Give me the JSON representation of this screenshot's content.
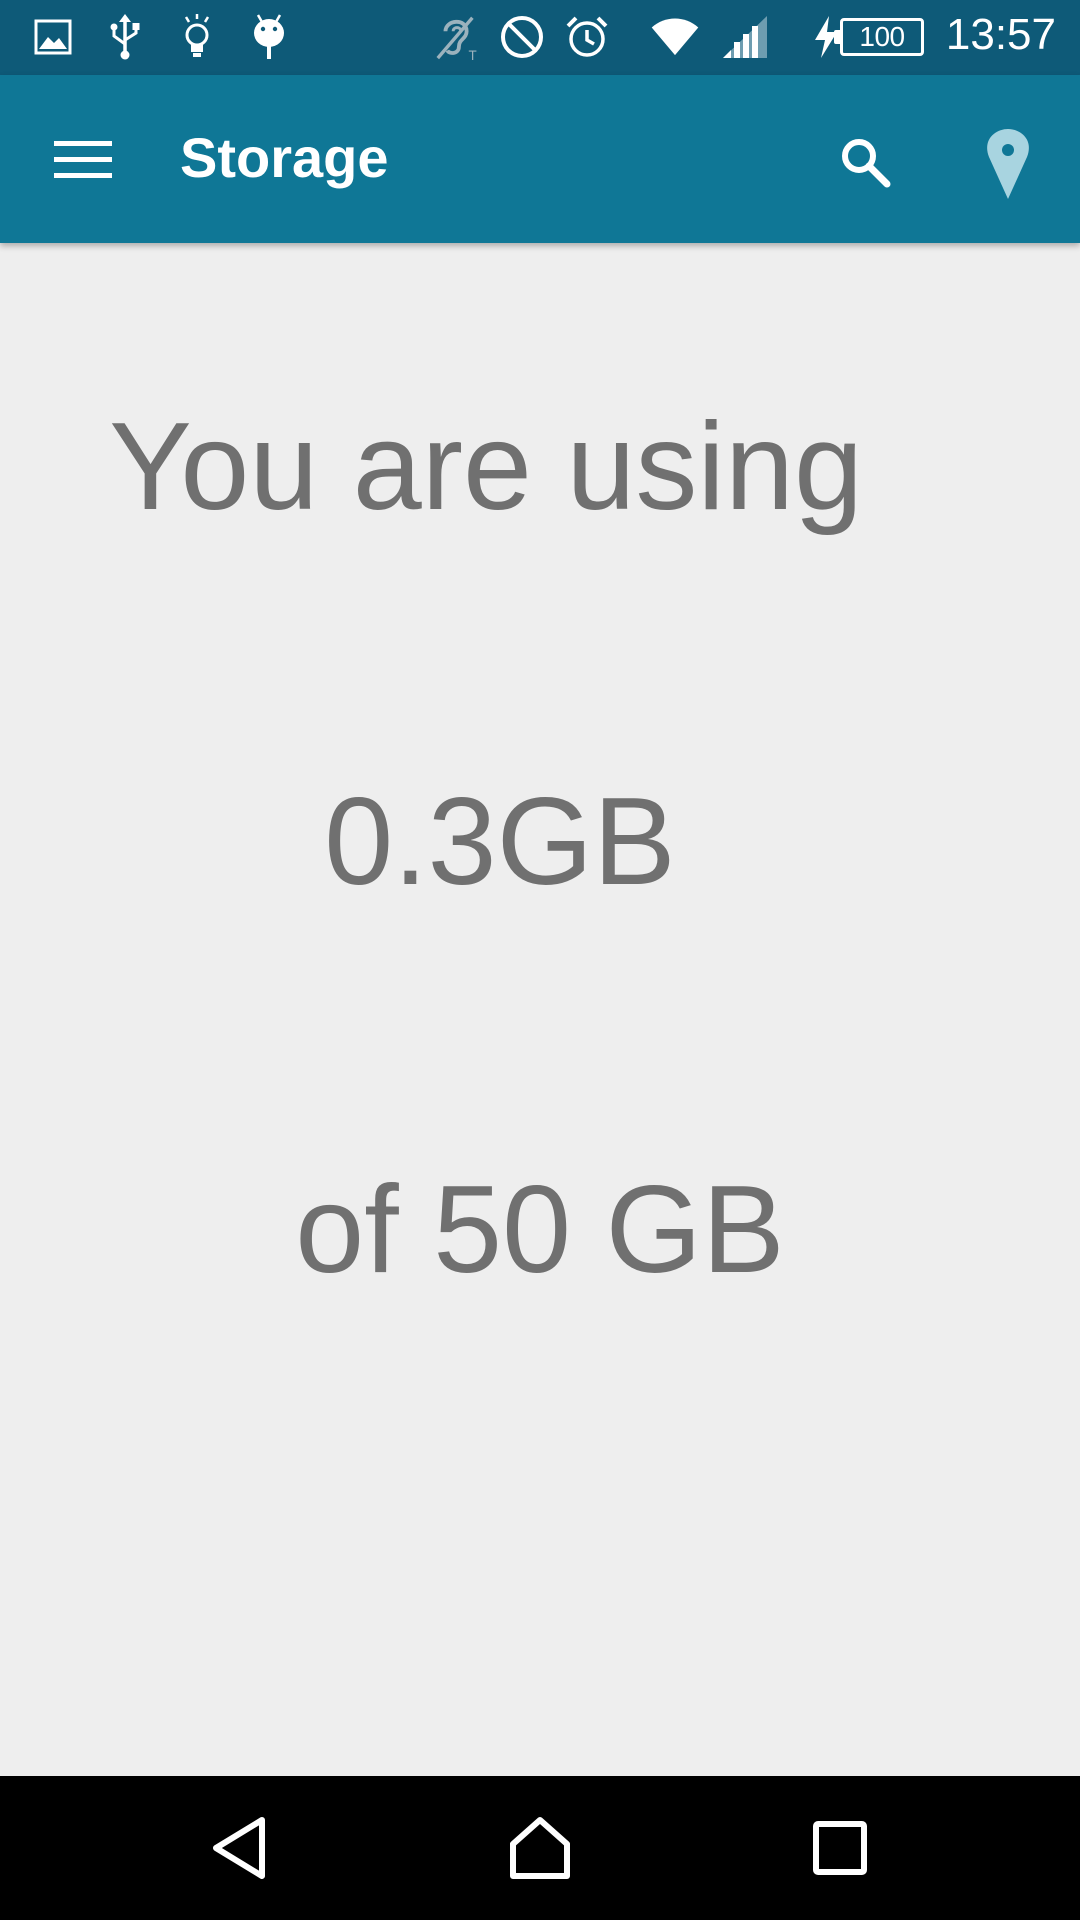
{
  "status_bar": {
    "icons": [
      "image-icon",
      "usb-icon",
      "lightbulb-icon",
      "android-icon",
      "hearing-aid-icon",
      "do-not-disturb-icon",
      "alarm-icon",
      "wifi-icon",
      "cellular-signal-icon",
      "charging-icon"
    ],
    "battery_level": "100",
    "time": "13:57"
  },
  "toolbar": {
    "title": "Storage",
    "accent_color": "#0f7796",
    "status_color": "#0e5a78"
  },
  "content": {
    "line_1": "You are using",
    "line_2": "0.3GB",
    "line_3": "of 50 GB",
    "text_color": "#707070"
  },
  "nav_bar": {
    "buttons": [
      "back-icon",
      "home-icon",
      "recents-icon"
    ]
  }
}
